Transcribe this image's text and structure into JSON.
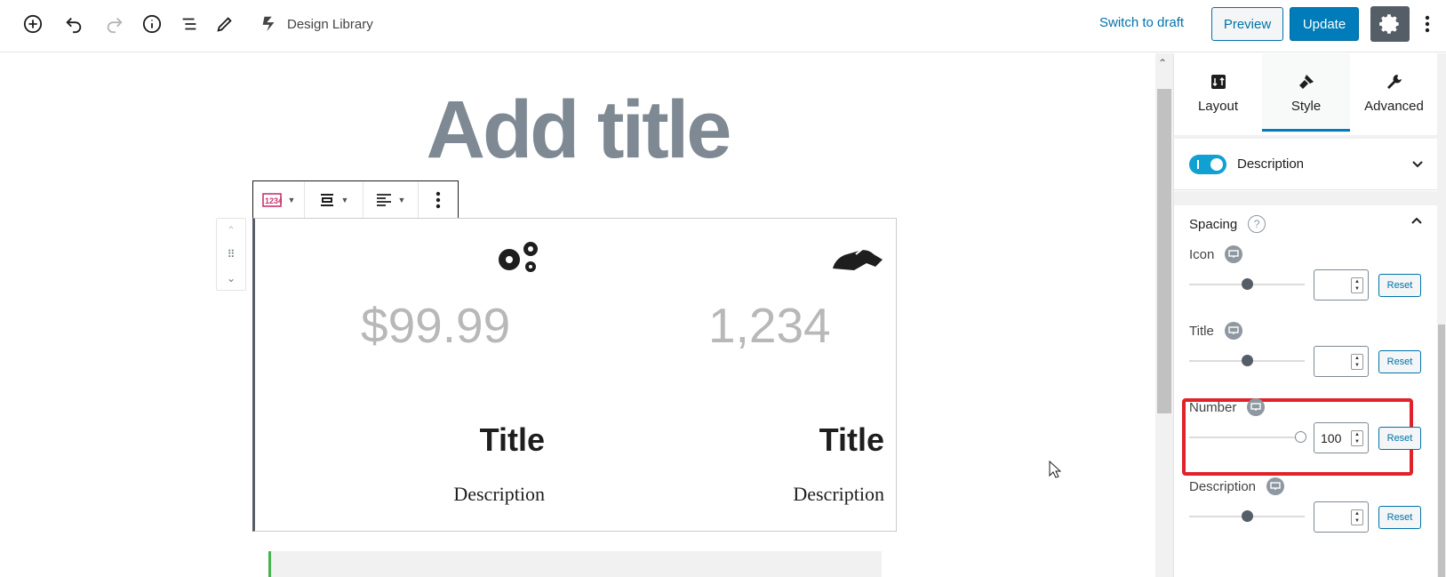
{
  "toolbar": {
    "design_library": "Design Library",
    "switch_to_draft": "Switch to draft",
    "preview": "Preview",
    "update": "Update"
  },
  "editor": {
    "post_title": "Add title",
    "columns": [
      {
        "number": "$99.99",
        "title": "Title",
        "description": "Description",
        "icon": "gears-icon"
      },
      {
        "number": "1,234",
        "title": "Title",
        "description": "Description",
        "icon": "handshake-icon"
      }
    ]
  },
  "sidebar": {
    "tabs": [
      {
        "label": "Layout",
        "icon": "layout-icon"
      },
      {
        "label": "Style",
        "icon": "brush-icon",
        "active": true
      },
      {
        "label": "Advanced",
        "icon": "wrench-icon"
      }
    ],
    "description_toggle": {
      "label": "Description",
      "enabled": true
    },
    "spacing": {
      "heading": "Spacing",
      "help": "?",
      "controls": [
        {
          "label": "Icon",
          "value": "",
          "slider": 0.5,
          "reset": "Reset"
        },
        {
          "label": "Title",
          "value": "",
          "slider": 0.5,
          "reset": "Reset"
        },
        {
          "label": "Number",
          "value": "100",
          "slider": 1.0,
          "reset": "Reset",
          "highlighted": true
        },
        {
          "label": "Description",
          "value": "",
          "slider": 0.5,
          "reset": "Reset"
        }
      ]
    }
  },
  "colors": {
    "accent": "#007cba",
    "highlight": "#e0222a",
    "toggle": "#11a0d2"
  }
}
